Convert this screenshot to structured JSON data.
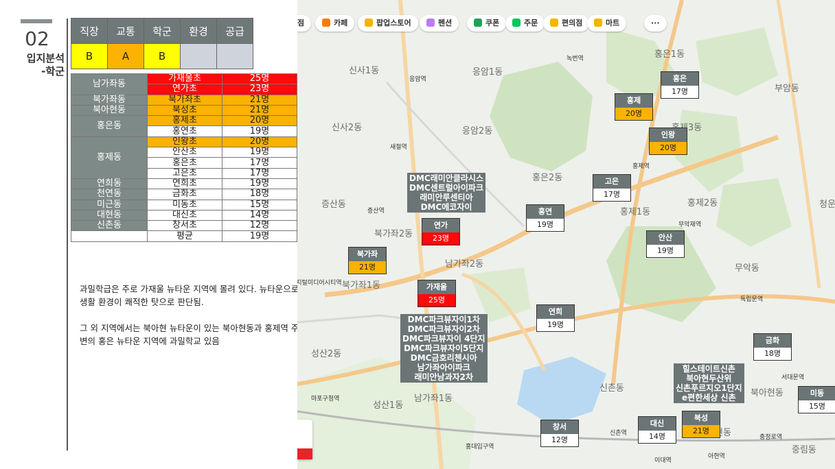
{
  "section": {
    "number": "02",
    "title_line1": "입지분석",
    "title_line2": "-학군"
  },
  "score_table": {
    "headers": [
      "직장",
      "교통",
      "학군",
      "환경",
      "공급"
    ],
    "grades": [
      "B",
      "A",
      "B",
      "",
      ""
    ],
    "grade_colors": [
      "#ffff00",
      "#fbb200",
      "#ffff00",
      "#cfd3dc",
      "#cfd3dc"
    ]
  },
  "school_table": {
    "groups": [
      {
        "dong": "남가좌동",
        "schools": [
          {
            "name": "가재울초",
            "students": "25명",
            "level": "red"
          },
          {
            "name": "연가초",
            "students": "23명",
            "level": "red"
          }
        ]
      },
      {
        "dong": "북가좌동",
        "schools": [
          {
            "name": "북가좌초",
            "students": "21명",
            "level": "orange"
          }
        ]
      },
      {
        "dong": "북아현동",
        "schools": [
          {
            "name": "북성초",
            "students": "21명",
            "level": "orange"
          }
        ]
      },
      {
        "dong": "홍은동",
        "schools": [
          {
            "name": "홍제초",
            "students": "20명",
            "level": "orange"
          },
          {
            "name": "홍연초",
            "students": "19명",
            "level": "white"
          }
        ]
      },
      {
        "dong": "홍제동",
        "schools": [
          {
            "name": "인왕초",
            "students": "20명",
            "level": "orange"
          },
          {
            "name": "안산초",
            "students": "19명",
            "level": "white"
          },
          {
            "name": "홍은초",
            "students": "17명",
            "level": "white"
          },
          {
            "name": "고은초",
            "students": "17명",
            "level": "white"
          }
        ]
      },
      {
        "dong": "연희동",
        "schools": [
          {
            "name": "연희초",
            "students": "19명",
            "level": "white"
          }
        ]
      },
      {
        "dong": "천연동",
        "schools": [
          {
            "name": "금화초",
            "students": "18명",
            "level": "white"
          }
        ]
      },
      {
        "dong": "미근동",
        "schools": [
          {
            "name": "미동초",
            "students": "15명",
            "level": "white"
          }
        ]
      },
      {
        "dong": "대현동",
        "schools": [
          {
            "name": "대신초",
            "students": "14명",
            "level": "white"
          }
        ]
      },
      {
        "dong": "신촌동",
        "schools": [
          {
            "name": "창서초",
            "students": "12명",
            "level": "white"
          }
        ]
      }
    ],
    "average": {
      "label": "평균",
      "students": "19명"
    }
  },
  "notes": [
    "과밀학급은 주로 가재울 뉴타운 지역에 몰려 있다. 뉴타운으로 생활 환경이 쾌적한 탓으로 판단됨.",
    "그 외 지역에서는 북아현 뉴타운이 있는 북아현동과 홍제역 주변의 홍은 뉴타운 지역에 과밀학교 있음"
  ],
  "map": {
    "chips": [
      {
        "label": "점",
        "icon": "none-icon",
        "color": "#ffffff"
      },
      {
        "label": "카페",
        "icon": "cafe-icon",
        "color": "#ff7a00"
      },
      {
        "label": "팝업스토어",
        "icon": "popup-icon",
        "color": "#f5b400"
      },
      {
        "label": "펜션",
        "icon": "bed-icon",
        "color": "#b97cff"
      },
      {
        "label": "쿠폰",
        "icon": "coupon-icon",
        "color": "#1ca35a"
      },
      {
        "label": "주문",
        "icon": "naver-order-icon",
        "color": "#03c75a"
      },
      {
        "label": "편의점",
        "icon": "store-icon",
        "color": "#f5b400"
      },
      {
        "label": "마트",
        "icon": "cart-icon",
        "color": "#f5b400"
      },
      {
        "label": "···",
        "icon": "more-icon",
        "color": "#ffffff"
      }
    ],
    "places": [
      "신사1동",
      "응암1동",
      "신사2동",
      "응암2동",
      "홍은1동",
      "홍은2동",
      "홍제3동",
      "홍제1동",
      "홍제2동",
      "부암동",
      "증산동",
      "북가좌2동",
      "남가좌2동",
      "북가좌1동",
      "성산2동",
      "성산1동",
      "신촌동",
      "무악동",
      "청운효",
      "중림동",
      "북아현동",
      "남가좌1동",
      "현동"
    ],
    "stations": [
      "녹번역",
      "응암역",
      "새절역",
      "홍제역",
      "증산역",
      "디지털미디어시티역",
      "마포구청역",
      "홍대입구역",
      "신촌역",
      "이대역",
      "아현역",
      "충정로역",
      "서대문역",
      "독립문역",
      "무악재역"
    ],
    "school_boxes": [
      {
        "name": "홍은",
        "students": "17명",
        "level": "white"
      },
      {
        "name": "홍제",
        "students": "20명",
        "level": "orange"
      },
      {
        "name": "인왕",
        "students": "20명",
        "level": "orange"
      },
      {
        "name": "고은",
        "students": "17명",
        "level": "white"
      },
      {
        "name": "홍연",
        "students": "19명",
        "level": "white"
      },
      {
        "name": "안산",
        "students": "19명",
        "level": "white"
      },
      {
        "name": "연가",
        "students": "23명",
        "level": "red"
      },
      {
        "name": "북가좌",
        "students": "21명",
        "level": "orange"
      },
      {
        "name": "가재울",
        "students": "25명",
        "level": "red"
      },
      {
        "name": "연희",
        "students": "19명",
        "level": "white"
      },
      {
        "name": "금화",
        "students": "18명",
        "level": "white"
      },
      {
        "name": "미동",
        "students": "15명",
        "level": "white"
      },
      {
        "name": "창서",
        "students": "12명",
        "level": "white"
      },
      {
        "name": "대신",
        "students": "14명",
        "level": "white"
      },
      {
        "name": "북성",
        "students": "21명",
        "level": "orange"
      }
    ],
    "apt_groups": [
      [
        "DMC래미안클라시스",
        "DMC센트럴아이파크",
        "래미안루센티아",
        "DMC에코자이"
      ],
      [
        "DMC파크뷰자이1차",
        "DMC파크뷰자이2차",
        "DMC파크뷰자이 4단지",
        "DMC파크뷰자이5단지",
        "DMC금호리첸시아",
        "남가좌아이파크",
        "래미안남과자2차"
      ],
      [
        "힐스테이트신촌",
        "북아현두산위",
        "신촌푸르지오1단지",
        "e편한세상 신촌"
      ]
    ],
    "colors": {
      "red": "#ff0a0a",
      "orange": "#fbb200",
      "white": "#ffffff"
    }
  }
}
